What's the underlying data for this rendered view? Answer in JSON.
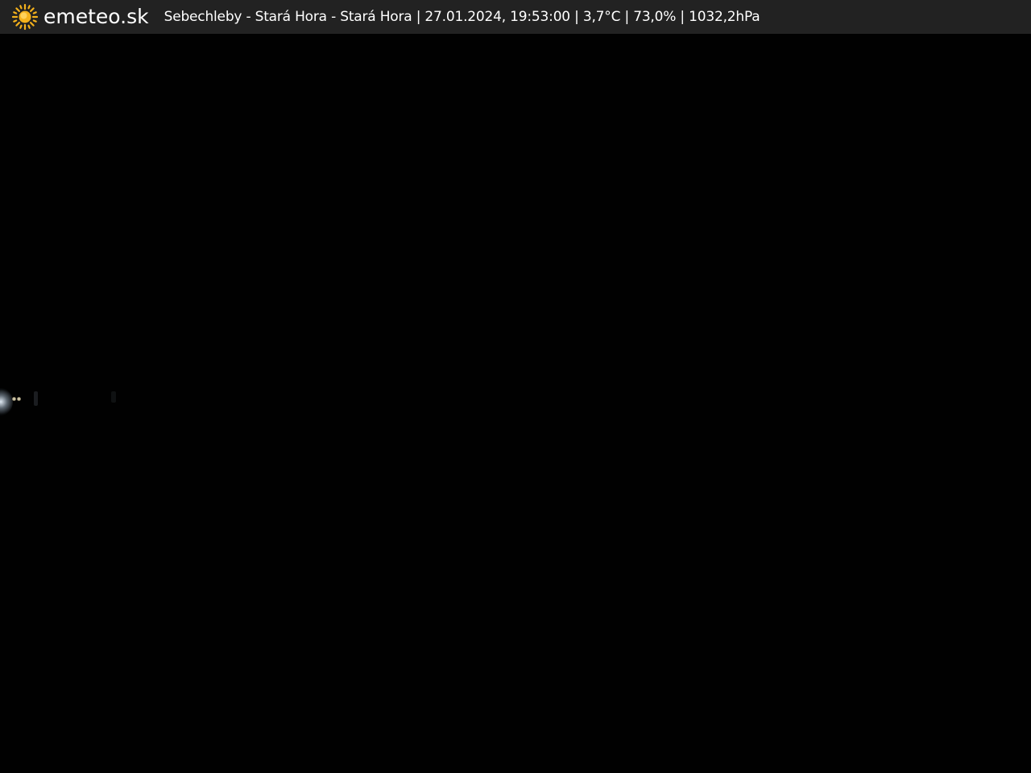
{
  "header": {
    "brand": "emeteo.sk",
    "logo_icon": "sun-icon",
    "caption": "Sebechleby - Stará Hora - Stará Hora | 27.01.2024, 19:53:00 | 3,7°C | 73,0% | 1032,2hPa"
  },
  "colors": {
    "header_background": "#222222",
    "header_text": "#ffffff",
    "sun_color": "#f5b21c",
    "image_background": "#010101"
  }
}
